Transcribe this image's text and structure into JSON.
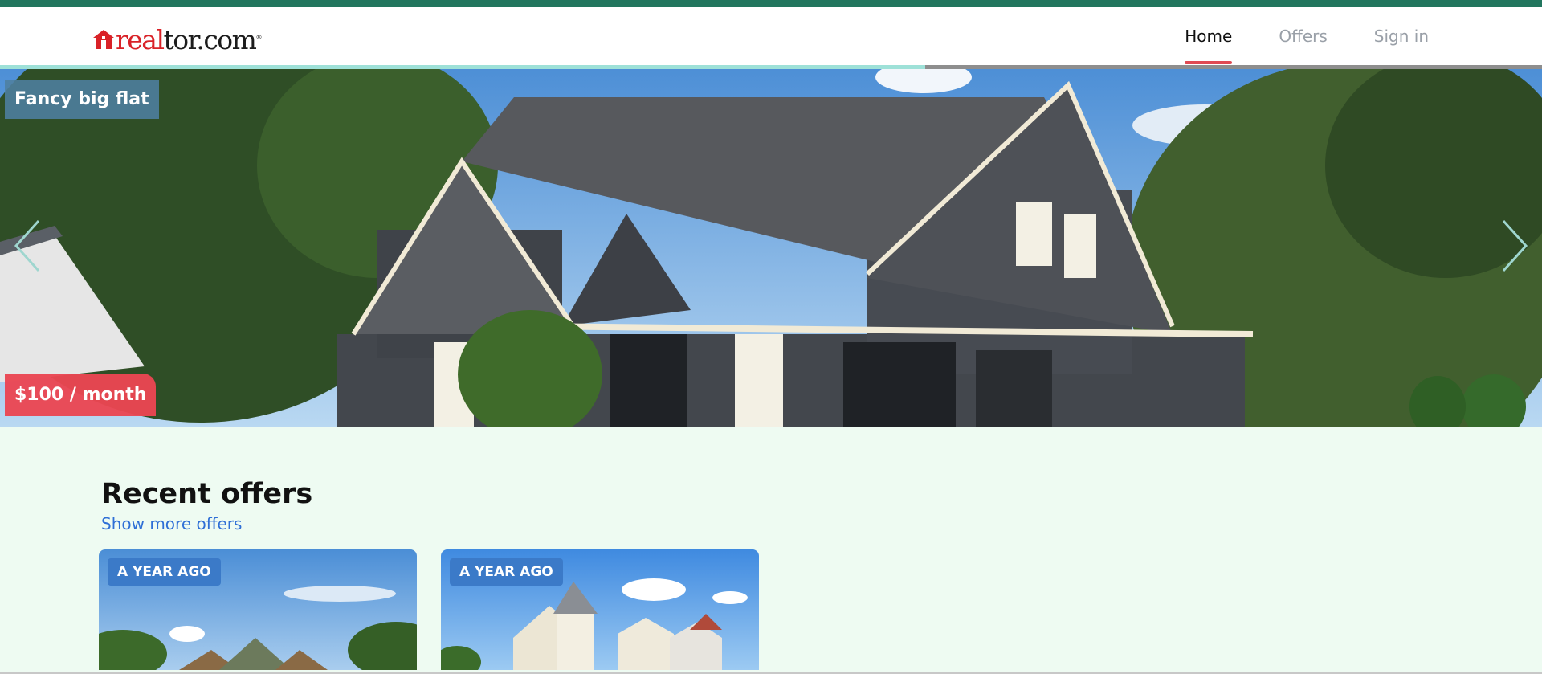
{
  "header": {
    "logo": {
      "part1": "real",
      "part2": "tor.com",
      "registered": "®"
    },
    "nav": [
      {
        "label": "Home",
        "active": true
      },
      {
        "label": "Offers",
        "active": false
      },
      {
        "label": "Sign in",
        "active": false
      }
    ]
  },
  "hero": {
    "title": "Fancy big flat",
    "price": "$100 / month",
    "slide_progress": 0.6
  },
  "recent": {
    "title": "Recent offers",
    "show_more": "Show more offers",
    "cards": [
      {
        "badge": "A YEAR AGO"
      },
      {
        "badge": "A YEAR AGO"
      }
    ]
  },
  "colors": {
    "brand_red": "#d92228",
    "accent_bar": "#22765e",
    "page_bg": "#eefbf2",
    "link": "#2f6fd6"
  }
}
